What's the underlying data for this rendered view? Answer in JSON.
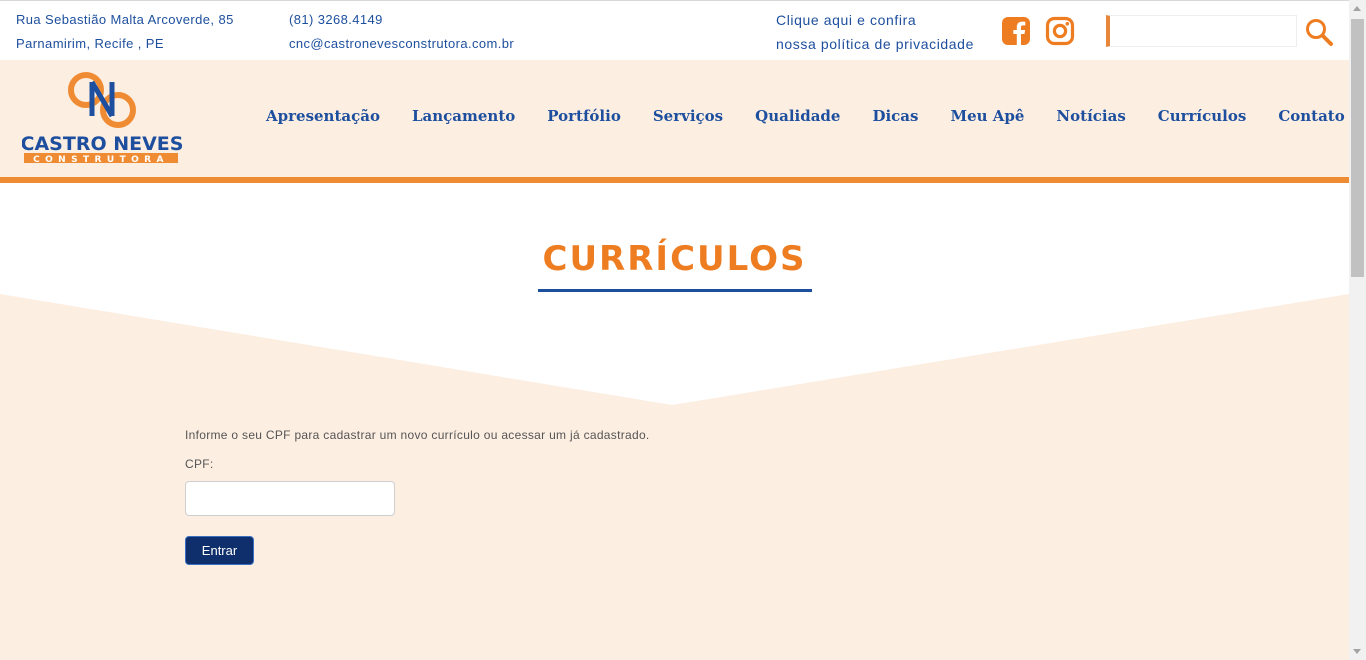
{
  "topbar": {
    "address_line1": "Rua Sebastião Malta Arcoverde, 85",
    "address_line2": "Parnamirim, Recife , PE",
    "phone": "(81) 3268.4149",
    "email": "cnc@castronevesconstrutora.com.br",
    "privacy_line1": "Clique aqui e confira",
    "privacy_line2": "nossa política de privacidade",
    "search_placeholder": ""
  },
  "icons": {
    "facebook": "facebook-icon",
    "instagram": "instagram-icon",
    "search": "search-icon"
  },
  "logo": {
    "name": "CASTRO NEVES",
    "sub": "CONSTRUTORA"
  },
  "nav": {
    "items": [
      "Apresentação",
      "Lançamento",
      "Portfólio",
      "Serviços",
      "Qualidade",
      "Dicas",
      "Meu Apê",
      "Notícias",
      "Currículos",
      "Contato"
    ]
  },
  "main": {
    "title": "CURRÍCULOS",
    "info": "Informe o seu CPF para cadastrar um novo currículo ou acessar um já cadastrado.",
    "cpf_label": "CPF:",
    "cpf_value": "",
    "submit_label": "Entrar"
  },
  "colors": {
    "orange": "#ef8c33",
    "blue": "#1d4f9e",
    "navy_button": "#0e2f6b",
    "peach": "#fdeee2"
  }
}
